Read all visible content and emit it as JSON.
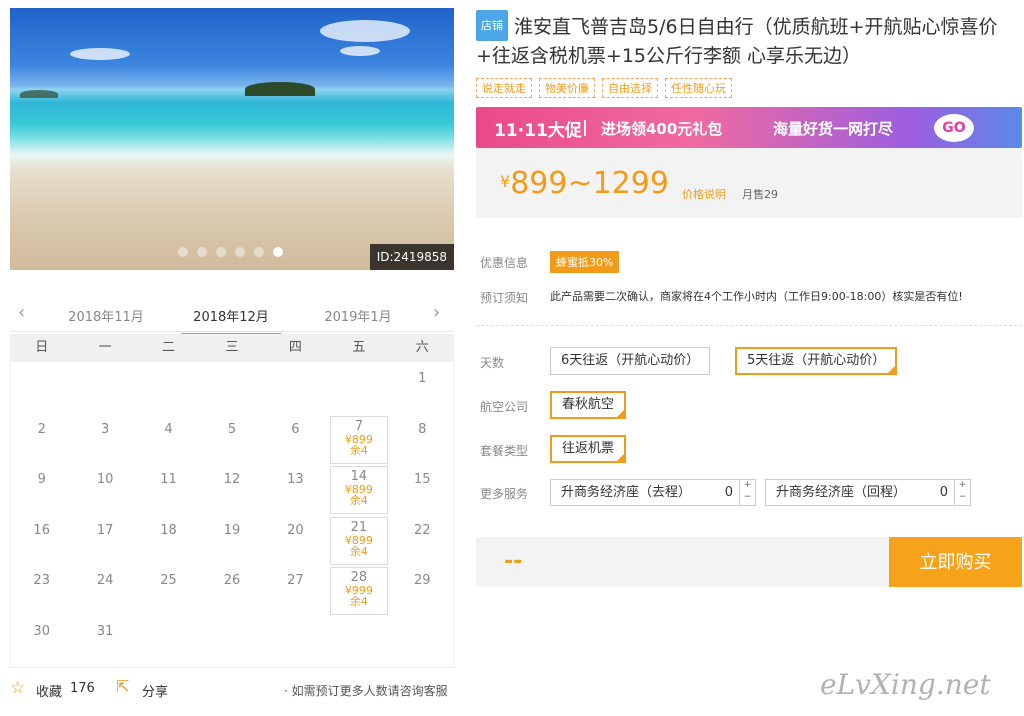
{
  "gallery": {
    "image_id": "ID:2419858",
    "dot_count": 6,
    "active_dot": 6
  },
  "calendar": {
    "prev_month": "2018年11月",
    "current_month": "2018年12月",
    "next_month": "2019年1月",
    "weekdays": [
      "日",
      "一",
      "二",
      "三",
      "四",
      "五",
      "六"
    ],
    "days": [
      {
        "d": "1",
        "row": 0,
        "col": 6
      },
      {
        "d": "2",
        "row": 1,
        "col": 0
      },
      {
        "d": "3",
        "row": 1,
        "col": 1
      },
      {
        "d": "4",
        "row": 1,
        "col": 2
      },
      {
        "d": "5",
        "row": 1,
        "col": 3
      },
      {
        "d": "6",
        "row": 1,
        "col": 4
      },
      {
        "d": "7",
        "row": 1,
        "col": 5,
        "price": "¥899",
        "remain": "余4"
      },
      {
        "d": "8",
        "row": 1,
        "col": 6
      },
      {
        "d": "9",
        "row": 2,
        "col": 0
      },
      {
        "d": "10",
        "row": 2,
        "col": 1
      },
      {
        "d": "11",
        "row": 2,
        "col": 2
      },
      {
        "d": "12",
        "row": 2,
        "col": 3
      },
      {
        "d": "13",
        "row": 2,
        "col": 4
      },
      {
        "d": "14",
        "row": 2,
        "col": 5,
        "price": "¥899",
        "remain": "余4"
      },
      {
        "d": "15",
        "row": 2,
        "col": 6
      },
      {
        "d": "16",
        "row": 3,
        "col": 0
      },
      {
        "d": "17",
        "row": 3,
        "col": 1
      },
      {
        "d": "18",
        "row": 3,
        "col": 2
      },
      {
        "d": "19",
        "row": 3,
        "col": 3
      },
      {
        "d": "20",
        "row": 3,
        "col": 4
      },
      {
        "d": "21",
        "row": 3,
        "col": 5,
        "price": "¥899",
        "remain": "余4"
      },
      {
        "d": "22",
        "row": 3,
        "col": 6
      },
      {
        "d": "23",
        "row": 4,
        "col": 0
      },
      {
        "d": "24",
        "row": 4,
        "col": 1
      },
      {
        "d": "25",
        "row": 4,
        "col": 2
      },
      {
        "d": "26",
        "row": 4,
        "col": 3
      },
      {
        "d": "27",
        "row": 4,
        "col": 4
      },
      {
        "d": "28",
        "row": 4,
        "col": 5,
        "price": "¥999",
        "remain": "余4"
      },
      {
        "d": "29",
        "row": 4,
        "col": 6
      },
      {
        "d": "30",
        "row": 5,
        "col": 0
      },
      {
        "d": "31",
        "row": 5,
        "col": 1
      }
    ]
  },
  "actions": {
    "favorite_label": "收藏",
    "favorite_count": "176",
    "share_label": "分享",
    "consult_note": "· 如需预订更多人数请咨询客服"
  },
  "product": {
    "shop_tag": "店铺",
    "title": "淮安直飞普吉岛5/6日自由行（优质航班+开航贴心惊喜价+往返含税机票+15公斤行李额 心享乐无边）",
    "tags": [
      "说走就走",
      "物美价廉",
      "自由选择",
      "任性随心玩"
    ]
  },
  "banner": {
    "part1": "11·11大促",
    "part2": "进场领400元礼包",
    "part3": "海量好货一网打尽",
    "go": "GO"
  },
  "price": {
    "symbol": "¥",
    "range": "899~1299",
    "note": "价格说明",
    "monthly_sales": "月售29"
  },
  "info": {
    "discount_label": "优惠信息",
    "discount_badge": "蜂蜜抵30%",
    "notice_label": "预订须知",
    "notice_text": "此产品需要二次确认，商家将在4个工作小时内（工作日9:00-18:00）核实是否有位!"
  },
  "options": {
    "days_label": "天数",
    "days": [
      "6天往返（开航心动价）",
      "5天往返（开航心动价）"
    ],
    "airline_label": "航空公司",
    "airline": "春秋航空",
    "package_label": "套餐类型",
    "package": "往返机票",
    "services_label": "更多服务",
    "services": [
      {
        "name": "升商务经济座（去程）",
        "qty": "0"
      },
      {
        "name": "升商务经济座（回程）",
        "qty": "0"
      }
    ]
  },
  "buy": {
    "price_placeholder": "--",
    "button": "立即购买"
  },
  "watermark": "eLvXing.net"
}
